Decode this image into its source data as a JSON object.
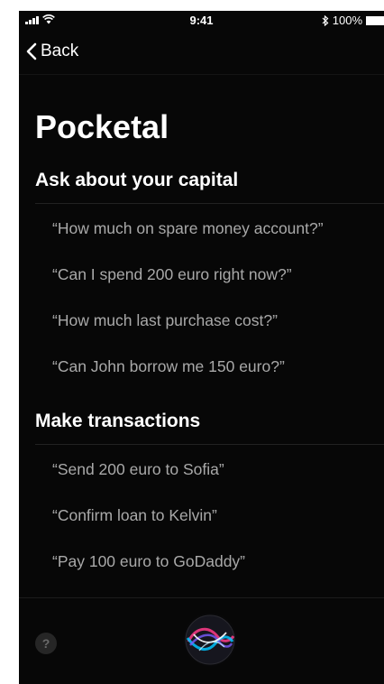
{
  "status_bar": {
    "time": "9:41",
    "battery": "100%",
    "icons": [
      "signal-icon",
      "wifi-icon",
      "bluetooth-icon",
      "battery-icon"
    ]
  },
  "nav": {
    "back_label": "Back"
  },
  "app_title": "Pocketal",
  "sections": [
    {
      "header": "Ask about your capital",
      "phrases": [
        "“How much on spare money account?”",
        "“Can I spend 200 euro right now?”",
        "“How much last purchase cost?”",
        "“Can John borrow me 150 euro?”"
      ]
    },
    {
      "header": "Make transactions",
      "phrases": [
        "“Send 200 euro to Sofia”",
        "“Confirm loan to Kelvin”",
        "“Pay 100 euro to GoDaddy”"
      ]
    }
  ],
  "footer": {
    "help_label": "?"
  },
  "colors": {
    "background": "#070707",
    "text": "#ffffff",
    "phrase": "#a9a9a9"
  }
}
